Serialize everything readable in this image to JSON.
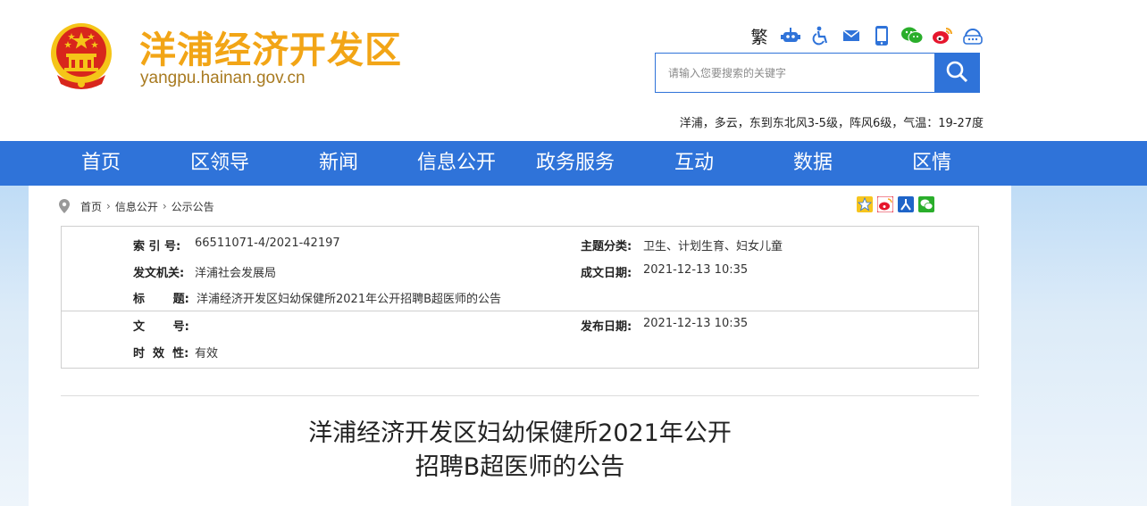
{
  "header": {
    "site_title": "洋浦经济开发区",
    "site_domain": "yangpu.hainan.gov.cn",
    "traditional_label": "繁",
    "tool_icons": [
      "robot-icon",
      "accessibility-icon",
      "mail-icon",
      "mobile-icon",
      "wechat-icon",
      "weibo-icon",
      "service-icon"
    ],
    "search": {
      "placeholder": "请输入您要搜索的关键字"
    },
    "weather": "洋浦，多云，东到东北风3-5级，阵风6级，气温：19-27度"
  },
  "nav": {
    "items": [
      "首页",
      "区领导",
      "新闻",
      "信息公开",
      "政务服务",
      "互动",
      "数据",
      "区情"
    ]
  },
  "breadcrumb": {
    "items": [
      "首页",
      "信息公开",
      "公示公告"
    ]
  },
  "share_icons": [
    "qzone-icon",
    "weibo-share-icon",
    "renren-icon",
    "wechat-share-icon"
  ],
  "info": {
    "index_label": "索  引  号:",
    "index_value": "66511071-4/2021-42197",
    "category_label": "主题分类:",
    "category_value": "卫生、计划生育、妇女儿童",
    "issuer_label": "发文机关:",
    "issuer_value": "洋浦社会发展局",
    "created_label": "成文日期:",
    "created_value": "2021-12-13 10:35",
    "title_label": "标       题:",
    "title_value": "洋浦经济开发区妇幼保健所2021年公开招聘B超医师的公告",
    "docno_label": "文       号:",
    "docno_value": "",
    "published_label": "发布日期:",
    "published_value": "2021-12-13 10:35",
    "validity_label": "时  效  性:",
    "validity_value": "有效"
  },
  "article": {
    "title_line1": "洋浦经济开发区妇幼保健所2021年公开",
    "title_line2": "招聘B超医师的公告"
  },
  "colors": {
    "brand_blue": "#2f73d9",
    "title_orange": "#f2a516",
    "emblem_red": "#d8261c",
    "emblem_gold": "#f5c518"
  }
}
